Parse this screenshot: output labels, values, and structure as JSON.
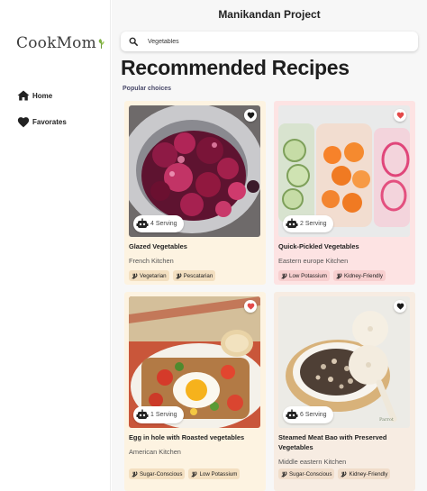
{
  "app": {
    "title": "Manikandan Project",
    "logo_text": "CookMom"
  },
  "sidebar": {
    "items": [
      {
        "label": "Home",
        "icon": "home-icon"
      },
      {
        "label": "Favorates",
        "icon": "heart-icon"
      }
    ]
  },
  "search": {
    "value": "Vegetables",
    "placeholder": "Search"
  },
  "page": {
    "title": "Recommended Recipes",
    "subtitle": "Popular choices"
  },
  "colors": {
    "favorite_active": "#e34a4a",
    "favorite_inactive": "#1a1a1a",
    "card_cream": "#fdf3e1",
    "card_pink": "#fde3e3"
  },
  "recipes": [
    {
      "title": "Glazed Vegetables",
      "cuisine": "French Kitchen",
      "serving": "4 Serving",
      "favorite": false,
      "tags": [
        "Vegetarian",
        "Pescatarian"
      ]
    },
    {
      "title": "Quick-Pickled Vegetables",
      "cuisine": "Eastern europe Kitchen",
      "serving": "2 Serving",
      "favorite": true,
      "tags": [
        "Low Potassium",
        "Kidney-Friendly"
      ]
    },
    {
      "title": "Egg in hole with Roasted vegetables",
      "cuisine": "American Kitchen",
      "serving": "1 Serving",
      "favorite": true,
      "tags": [
        "Sugar-Conscious",
        "Low Potassium"
      ]
    },
    {
      "title": "Steamed Meat Bao with Preserved Vegetables",
      "cuisine": "Middle eastern Kitchen",
      "serving": "6 Serving",
      "favorite": false,
      "tags": [
        "Sugar-Conscious",
        "Kidney-Friendly"
      ]
    }
  ]
}
